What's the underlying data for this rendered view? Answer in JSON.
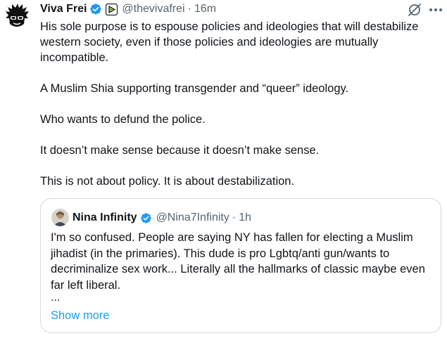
{
  "tweet": {
    "author_name": "Viva Frei",
    "handle": "@thevivafrei",
    "separator": "·",
    "time": "16m",
    "paragraphs": [
      "His sole purpose is to espouse policies and ideologies that will destabilize western society, even if those policies and ideologies are mutually incompatible.",
      "A Muslim Shia supporting transgender and “queer” ideology.",
      "Who wants to defund the police.",
      "It doesn’t make sense because it doesn’t make sense.",
      "This is not about policy. It is about destabilization."
    ]
  },
  "quoted_tweet": {
    "author_name": "Nina Infinity",
    "handle": "@Nina7Infinity",
    "separator": "·",
    "time": "1h",
    "text": "I'm so confused. People are saying NY has fallen for electing a Muslim jihadist (in the primaries). This dude is pro Lgbtq/anti gun/wants to decriminalize sex work... Literally all the hallmarks of classic maybe even far left liberal.",
    "ellipsis": "...",
    "show_more_label": "Show more"
  },
  "icons": {
    "verified": "verified-badge-icon",
    "affiliate": "rumble-affiliate-icon",
    "grok": "grok-icon",
    "more": "more-options-icon"
  },
  "colors": {
    "verified_blue": "#1d9bf0",
    "secondary_text": "#536471",
    "link_blue": "#1d9bf0",
    "border": "#cfd9de",
    "affiliate_green": "#85c742"
  }
}
